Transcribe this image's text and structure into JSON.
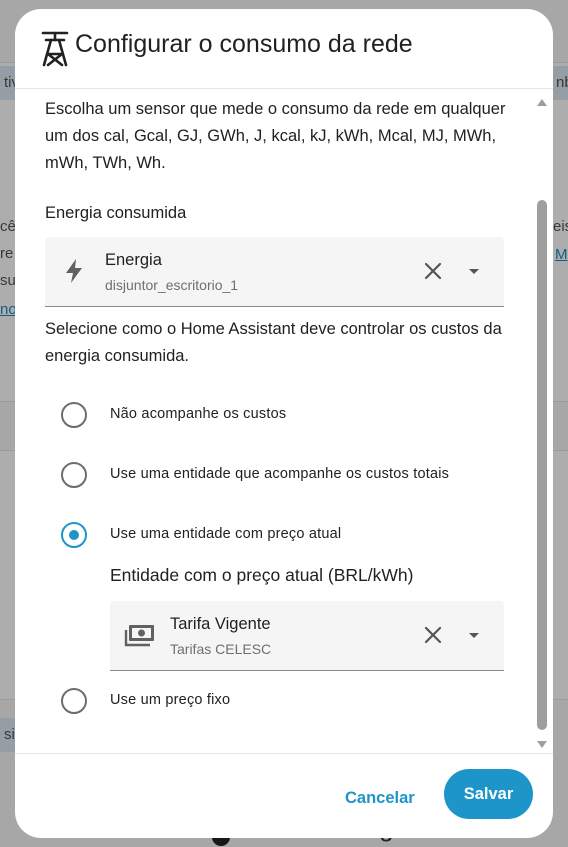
{
  "background": {
    "chips": [
      "tiv",
      "nb",
      "sity"
    ],
    "fragments": [
      "cê",
      "re",
      "su",
      "no",
      "eis",
      "M"
    ],
    "bottom_title": "Consumo de água"
  },
  "dialog": {
    "title_icon": "transmission-tower-icon",
    "title": "Configurar o consumo da rede",
    "intro": "Escolha um sensor que mede o consumo da rede em qualquer um dos cal, Gcal, GJ, GWh, J, kcal, kJ, kWh, Mcal, MJ, MWh, mWh, TWh, Wh.",
    "energy_label": "Energia consumida",
    "energy_picker": {
      "icon": "lightning-bolt-icon",
      "name": "Energia",
      "entity": "disjuntor_escritorio_1"
    },
    "cost_intro": "Selecione como o Home Assistant deve controlar os custos da energia consumida.",
    "cost_options": [
      {
        "label": "Não acompanhe os custos",
        "checked": false
      },
      {
        "label": "Use uma entidade que acompanhe os custos totais",
        "checked": false
      },
      {
        "label": "Use uma entidade com preço atual",
        "checked": true
      },
      {
        "label": "Use um preço fixo",
        "checked": false
      }
    ],
    "price_entity_label": "Entidade com o preço atual (BRL/kWh)",
    "price_picker": {
      "icon": "cash-icon",
      "name": "Tarifa Vigente",
      "entity": "Tarifas CELESC"
    },
    "cancel_label": "Cancelar",
    "save_label": "Salvar"
  },
  "colors": {
    "accent": "#1e95c8",
    "text": "#212121",
    "secondary_text": "#6f6f6f",
    "picker_bg": "#f5f5f5"
  }
}
